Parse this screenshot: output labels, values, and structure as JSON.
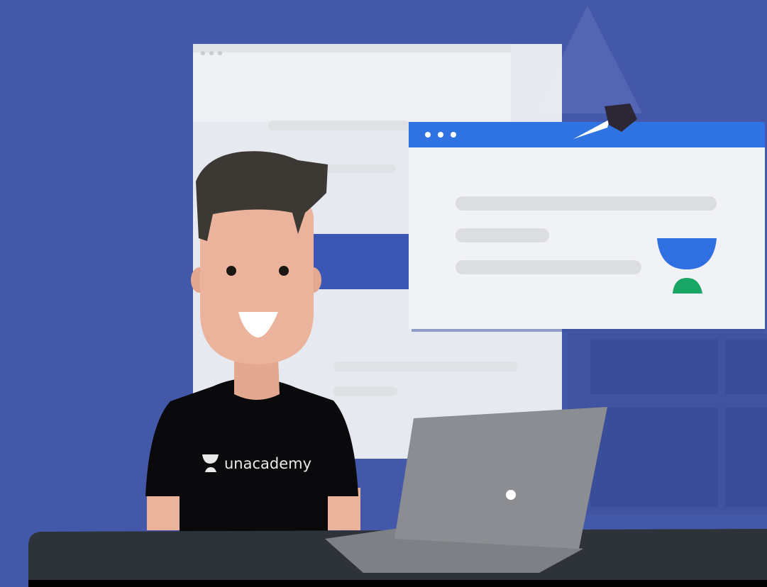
{
  "tshirt": {
    "brand": "unacademy"
  },
  "colors": {
    "background": "#4358a8",
    "window_titlebar": "#2f73e3",
    "logo_top": "#2f6fe2",
    "logo_bottom": "#18a565",
    "shirt": "#0a0a0c",
    "desk": "#2e3339",
    "laptop": "#8b8d92",
    "hair": "#3c3834",
    "skin": "#ebb39b"
  },
  "icons": [
    "unacademy-logo-icon",
    "window-dots-icon",
    "laptop-logo-icon"
  ]
}
